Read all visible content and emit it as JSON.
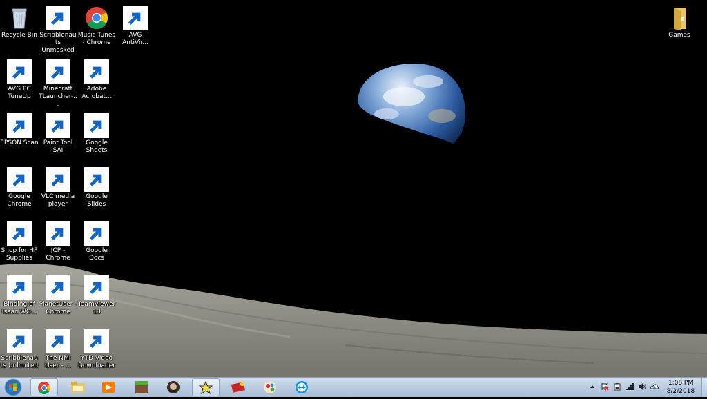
{
  "desktop": {
    "icons": [
      {
        "label": "Recycle Bin",
        "icon": "recycle-bin-icon"
      },
      {
        "label": "Scribblenauts Unmasked",
        "icon": "scribblenauts-unmasked-icon"
      },
      {
        "label": "Music Tunes - Chrome",
        "icon": "chrome-icon"
      },
      {
        "label": "AVG AntiVir...",
        "icon": "avg-antivirus-icon"
      },
      {
        "label": "AVG PC TuneUp",
        "icon": "avg-pc-tuneup-icon"
      },
      {
        "label": "Minecraft TLauncher-...",
        "icon": "minecraft-icon"
      },
      {
        "label": "Adobe Acrobat...",
        "icon": "adobe-acrobat-icon"
      },
      {
        "label": "EPSON Scan",
        "icon": "epson-scan-icon"
      },
      {
        "label": "Paint Tool SAI",
        "icon": "paint-tool-sai-icon"
      },
      {
        "label": "Google Sheets",
        "icon": "google-sheets-icon"
      },
      {
        "label": "Google Chrome",
        "icon": "chrome-icon"
      },
      {
        "label": "VLC media player",
        "icon": "vlc-icon"
      },
      {
        "label": "Google Slides",
        "icon": "google-slides-icon"
      },
      {
        "label": "Shop for HP Supplies",
        "icon": "hp-printer-icon"
      },
      {
        "label": "JCP - Chrome",
        "icon": "chrome-icon"
      },
      {
        "label": "Google Docs",
        "icon": "google-docs-icon"
      },
      {
        "label": "Binding of Isaac WO...",
        "icon": "binding-of-isaac-icon"
      },
      {
        "label": "PlanetUser - Chrome",
        "icon": "chrome-icon"
      },
      {
        "label": "TeamViewer 13",
        "icon": "teamviewer-icon"
      },
      {
        "label": "Scribblenauts Unlimited",
        "icon": "scribblenauts-unlimited-icon"
      },
      {
        "label": "The NMI User - ...",
        "icon": "chrome-icon"
      },
      {
        "label": "YTD Video Downloader",
        "icon": "ytd-downloader-icon"
      },
      {
        "label": "Games",
        "icon": "folder-icon"
      }
    ]
  },
  "taskbar": {
    "start": "windows-start-orb-icon",
    "pinned": [
      "chrome-icon",
      "file-explorer-icon",
      "media-player-icon",
      "minecraft-icon",
      "binding-of-isaac-icon",
      "scribblenauts-unlimited-icon",
      "scribblenauts-unmasked-icon",
      "paint-tool-sai-icon",
      "teamviewer-icon"
    ],
    "tray": [
      "show-hidden-icons-chevron",
      "action-center-flag-icon",
      "battery-icon",
      "network-signal-icon",
      "volume-icon",
      "cloud-icon"
    ]
  },
  "clock": {
    "time": "1:08 PM",
    "date": "8/2/2018"
  },
  "colors": {
    "chrome_red": "#db4437",
    "chrome_yellow": "#f4c20d",
    "chrome_green": "#0f9d58",
    "chrome_blue": "#4285f4",
    "taskbar": "#bccde3"
  }
}
